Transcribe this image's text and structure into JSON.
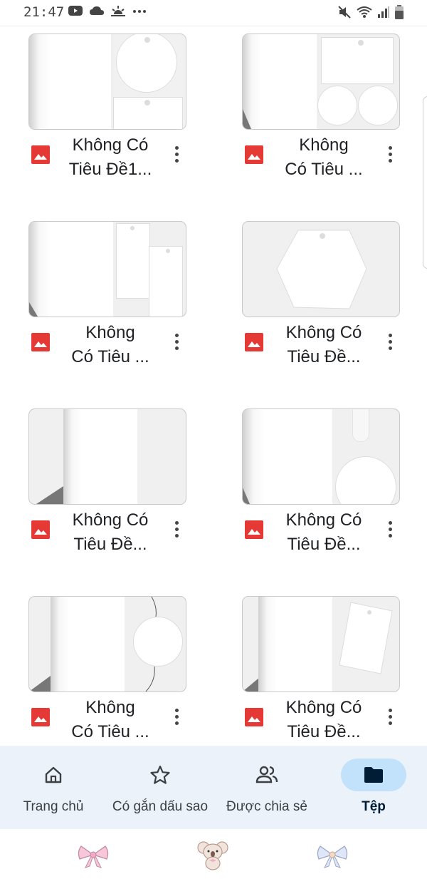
{
  "status_bar": {
    "time": "21:47",
    "left_icons": [
      "youtube-icon",
      "cloud-icon",
      "sunrise-icon",
      "more-horizontal-icon"
    ],
    "right_icons": [
      "mute-icon",
      "wifi-icon",
      "signal-icon",
      "battery-icon"
    ]
  },
  "files": [
    {
      "line1": "Không Có",
      "line2": "Tiêu Đề1..."
    },
    {
      "line1": "Không",
      "line2": "Có Tiêu ..."
    },
    {
      "line1": "Không",
      "line2": "Có Tiêu ..."
    },
    {
      "line1": "Không Có",
      "line2": "Tiêu Đề..."
    },
    {
      "line1": "Không Có",
      "line2": "Tiêu Đề..."
    },
    {
      "line1": "Không Có",
      "line2": "Tiêu Đề..."
    },
    {
      "line1": "Không",
      "line2": "Có Tiêu ..."
    },
    {
      "line1": "Không Có",
      "line2": "Tiêu Đề..."
    }
  ],
  "bottom_nav": {
    "home": "Trang chủ",
    "starred": "Có gắn dấu sao",
    "shared": "Được chia sẻ",
    "files": "Tệp",
    "active": "files"
  },
  "colors": {
    "image_icon": "#e53935",
    "nav_background": "#ecf2fa",
    "active_pill": "#c2e2fb"
  }
}
